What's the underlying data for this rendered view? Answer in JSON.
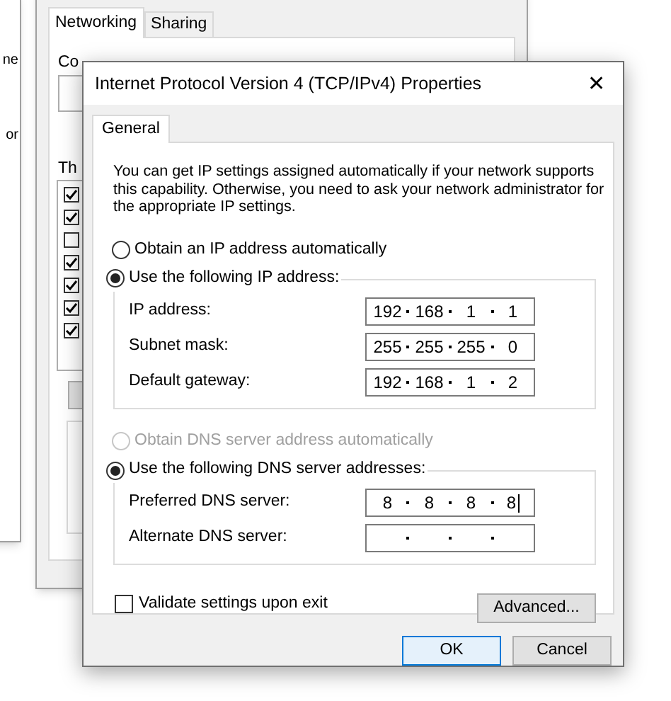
{
  "back_window_left": {
    "fragments": [
      "ne",
      "or"
    ]
  },
  "back_window": {
    "tabs": [
      {
        "label": "Networking",
        "selected": true
      },
      {
        "label": "Sharing",
        "selected": false
      }
    ],
    "fragments": [
      "Co",
      "Th"
    ],
    "list_checkboxes": [
      {
        "checked": true
      },
      {
        "checked": true
      },
      {
        "checked": false
      },
      {
        "checked": true
      },
      {
        "checked": true
      },
      {
        "checked": true
      },
      {
        "checked": true
      }
    ]
  },
  "dialog": {
    "title": "Internet Protocol Version 4 (TCP/IPv4) Properties",
    "close": "✕",
    "tabs": [
      {
        "label": "General",
        "selected": true
      }
    ],
    "description": "You can get IP settings assigned automatically if your network supports this capability. Otherwise, you need to ask your network administrator for the appropriate IP settings.",
    "ip_options": [
      {
        "label": "Obtain an IP address automatically",
        "selected": false,
        "disabled": false
      },
      {
        "label": "Use the following IP address:",
        "selected": true,
        "disabled": false
      }
    ],
    "ip_fields": [
      {
        "label": "IP address:",
        "octets": [
          "192",
          "168",
          "1",
          "1"
        ]
      },
      {
        "label": "Subnet mask:",
        "octets": [
          "255",
          "255",
          "255",
          "0"
        ]
      },
      {
        "label": "Default gateway:",
        "octets": [
          "192",
          "168",
          "1",
          "2"
        ]
      }
    ],
    "dns_options": [
      {
        "label": "Obtain DNS server address automatically",
        "selected": false,
        "disabled": true
      },
      {
        "label": "Use the following DNS server addresses:",
        "selected": true,
        "disabled": false
      }
    ],
    "dns_fields": [
      {
        "label": "Preferred DNS server:",
        "octets": [
          "8",
          "8",
          "8",
          "8"
        ],
        "focused": true
      },
      {
        "label": "Alternate DNS server:"
      }
    ],
    "validate": {
      "label": "Validate settings upon exit",
      "checked": false
    },
    "advanced_button": "Advanced...",
    "buttons": [
      {
        "label": "OK",
        "default": true
      },
      {
        "label": "Cancel",
        "default": false
      }
    ]
  }
}
